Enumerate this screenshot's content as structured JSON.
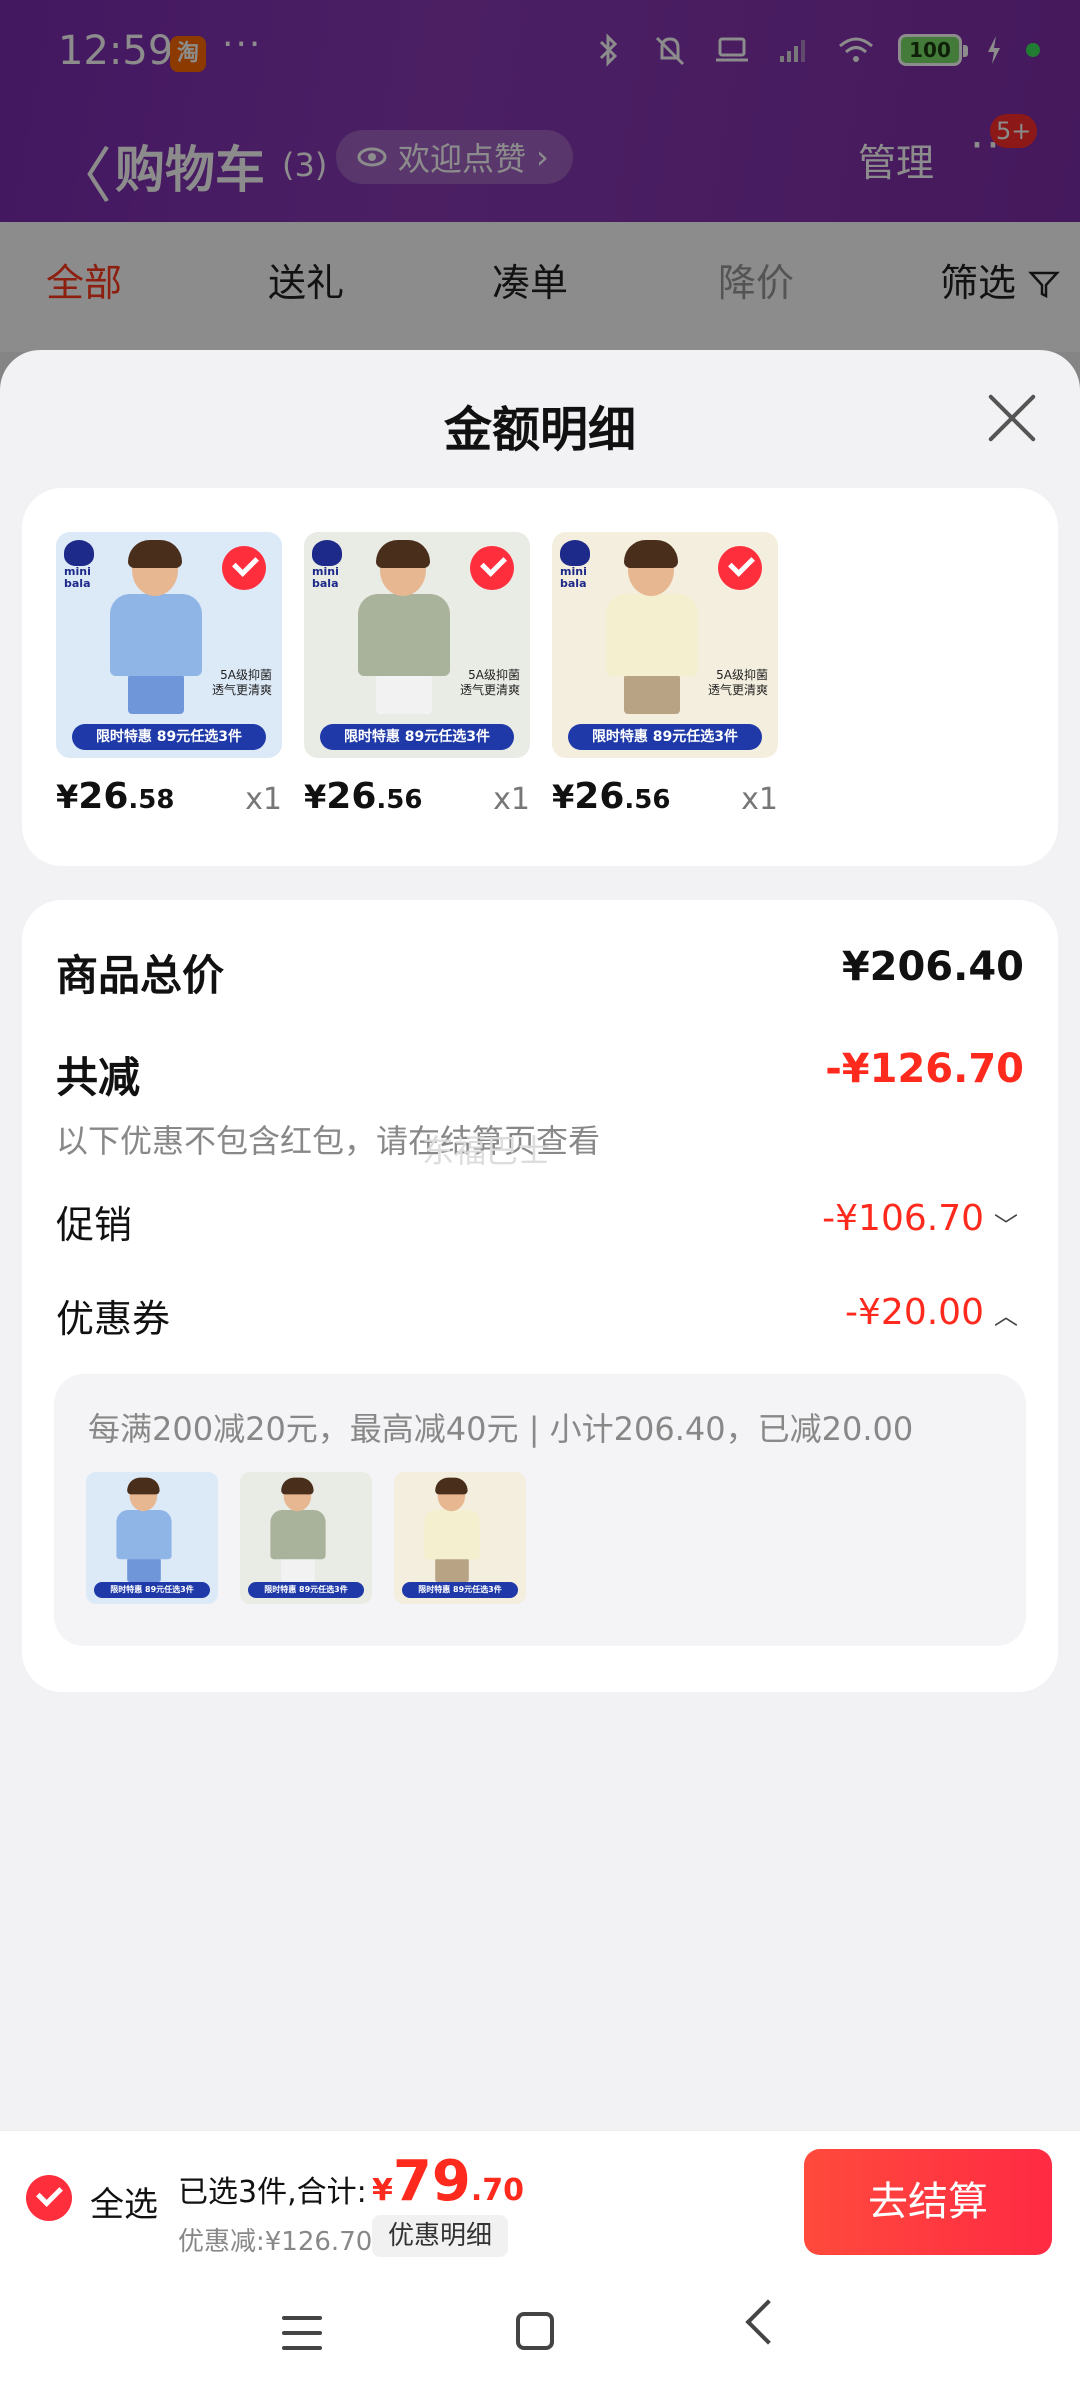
{
  "status_bar": {
    "time": "12:59",
    "app_badge": "淘",
    "dots": "···",
    "battery": "100"
  },
  "header": {
    "back_glyph": "〈",
    "title": "购物车",
    "count": "(3)",
    "welcome": "欢迎点赞",
    "welcome_arrow": "›",
    "manage": "管理",
    "more_glyph": "···",
    "badge": "5+"
  },
  "tabs": [
    {
      "label": "全部"
    },
    {
      "label": "送礼"
    },
    {
      "label": "凑单"
    },
    {
      "label": "降价"
    },
    {
      "label": "筛选"
    }
  ],
  "sheet": {
    "title": "金额明细"
  },
  "products": [
    {
      "price_sym": "¥",
      "price_int": "26",
      "price_dec": ".58",
      "qty": "x1",
      "shirt_color": "#8fb4e6",
      "bg": "#dce9f7",
      "legs_color": "#6e96d9"
    },
    {
      "price_sym": "¥",
      "price_int": "26",
      "price_dec": ".56",
      "qty": "x1",
      "shirt_color": "#a9b29a",
      "bg": "#e9ebe5",
      "legs_color": "#f2f2f2"
    },
    {
      "price_sym": "¥",
      "price_int": "26",
      "price_dec": ".56",
      "qty": "x1",
      "shirt_color": "#f3efcf",
      "bg": "#f3eedd",
      "legs_color": "#b8a384"
    }
  ],
  "product_tag": "5A级抑菌\n透气更清爽",
  "product_banner": "限时特惠 89元任选3件",
  "product_logo": "mini bala",
  "summary": {
    "total_label": "商品总价",
    "total_value": "¥206.40",
    "reduce_label": "共减",
    "reduce_value": "-¥126.70",
    "note": "以下优惠不包含红包，请在结算页查看",
    "watermark": "东福巴士",
    "promo_label": "促销",
    "promo_value": "-¥106.70",
    "promo_chevron": "﹀",
    "coupon_label": "优惠券",
    "coupon_value": "-¥20.00",
    "coupon_chevron": "︿",
    "coupon_desc": "每满200减20元，最高减40元 | 小计206.40，已减20.00"
  },
  "bottom_bar": {
    "select_all": "全选",
    "selected_info": "已选3件,合计:",
    "total_sym": "¥",
    "total_int": "79",
    "total_dec": ".70",
    "discount": "优惠减:¥126.70",
    "detail_btn": "优惠明细",
    "checkout": "去结算"
  },
  "colors": {
    "accent_red": "#ff2a1e",
    "header_purple": "#7b2cb0",
    "checkout_red": "#ff3a43"
  }
}
